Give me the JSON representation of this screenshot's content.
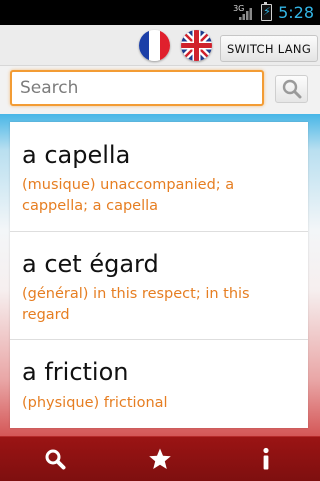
{
  "status_bar": {
    "network": "3G",
    "time": "5:28"
  },
  "top_bar": {
    "switch_lang_label": "SWITCH LANG"
  },
  "search": {
    "placeholder": "Search",
    "value": ""
  },
  "entries": [
    {
      "term": "a capella",
      "definition": "(musique) unaccompanied; a cappella; a capella"
    },
    {
      "term": "a cet égard",
      "definition": "(général) in this respect; in this regard"
    },
    {
      "term": "a friction",
      "definition": "(physique) frictional"
    }
  ],
  "bottom_bar": {
    "tabs": [
      "search-icon",
      "star-icon",
      "info-icon"
    ]
  },
  "colors": {
    "definition": "#e67e22",
    "bottom_bar": "#8b1212",
    "search_border": "#f39c34",
    "clock": "#33b5e5"
  }
}
